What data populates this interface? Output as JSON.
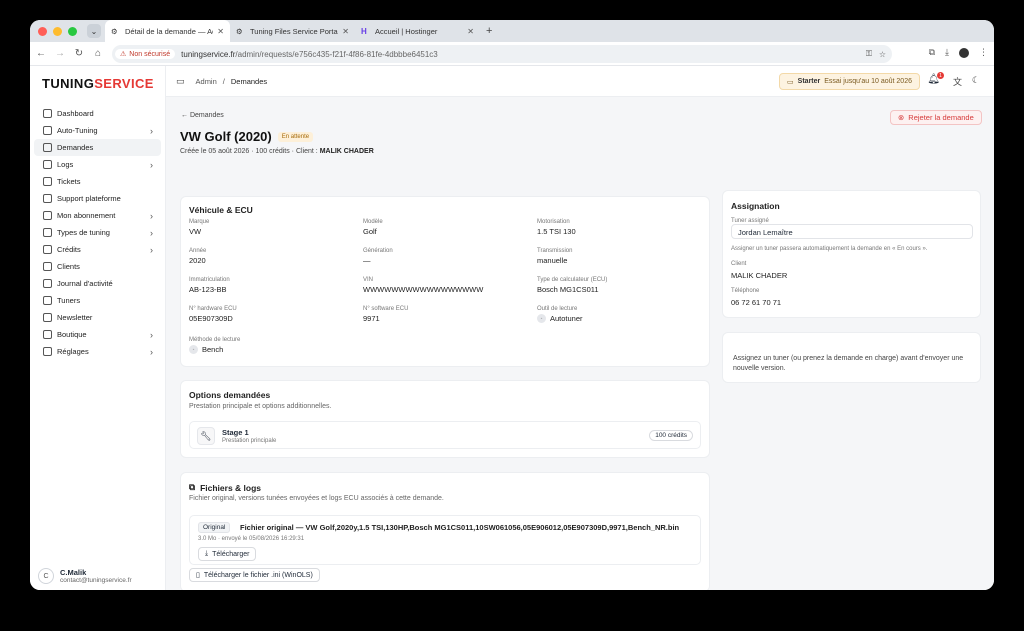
{
  "browser": {
    "tabs": [
      {
        "label": "Détail de la demande — Admi",
        "active": true
      },
      {
        "label": "Tuning Files Service Portal –",
        "active": false
      },
      {
        "label": "Accueil | Hostinger",
        "active": false
      }
    ],
    "insecure_label": "Non sécurisé",
    "url_host": "tuningservice.fr",
    "url_path": "/admin/requests/e756c435-f21f-4f86-81fe-4dbbbe6451c3"
  },
  "sidebar": {
    "brand_a": "TUNING",
    "brand_b": "SERVICE",
    "items": [
      {
        "label": "Dashboard",
        "icon": "grid-icon",
        "arrow": false
      },
      {
        "label": "Auto-Tuning",
        "icon": "cpu-icon",
        "arrow": true
      },
      {
        "label": "Demandes",
        "icon": "file-icon",
        "arrow": false,
        "active": true
      },
      {
        "label": "Logs",
        "icon": "doc-icon",
        "arrow": true
      },
      {
        "label": "Tickets",
        "icon": "ticket-icon",
        "arrow": false
      },
      {
        "label": "Support plateforme",
        "icon": "help-icon",
        "arrow": false
      },
      {
        "label": "Mon abonnement",
        "icon": "card-icon",
        "arrow": true
      },
      {
        "label": "Types de tuning",
        "icon": "car-icon",
        "arrow": true
      },
      {
        "label": "Crédits",
        "icon": "coins-icon",
        "arrow": true
      },
      {
        "label": "Clients",
        "icon": "users-icon",
        "arrow": false
      },
      {
        "label": "Journal d'activité",
        "icon": "history-icon",
        "arrow": false
      },
      {
        "label": "Tuners",
        "icon": "wrench-icon",
        "arrow": false
      },
      {
        "label": "Newsletter",
        "icon": "mail-icon",
        "arrow": false
      },
      {
        "label": "Boutique",
        "icon": "shop-icon",
        "arrow": true
      },
      {
        "label": "Réglages",
        "icon": "gear-icon",
        "arrow": true
      }
    ],
    "user": {
      "initial": "C",
      "name": "C.Malik",
      "email": "contact@tuningservice.fr"
    }
  },
  "topbar": {
    "crumb_root": "Admin",
    "crumb_current": "Demandes",
    "plan_name": "Starter",
    "plan_note": "Essai jusqu'au 10 août 2026",
    "notif_count": "1"
  },
  "page": {
    "back_label": "Demandes",
    "reject_label": "Rejeter la demande",
    "title": "VW Golf (2020)",
    "status": "En attente",
    "meta_prefix": "Créée le 05 août 2026 · 100 crédits · Client : ",
    "meta_client": "MALIK CHADER"
  },
  "vehicle": {
    "title": "Véhicule & ECU",
    "fields": [
      {
        "label": "Marque",
        "value": "VW"
      },
      {
        "label": "Modèle",
        "value": "Golf"
      },
      {
        "label": "Motorisation",
        "value": "1.5 TSI 130"
      },
      {
        "label": "Année",
        "value": "2020"
      },
      {
        "label": "Génération",
        "value": "—"
      },
      {
        "label": "Transmission",
        "value": "manuelle"
      },
      {
        "label": "Immatriculation",
        "value": "AB-123-BB"
      },
      {
        "label": "VIN",
        "value": "WWWWWWWWWWWWWWWWW"
      },
      {
        "label": "Type de calculateur (ECU)",
        "value": "Bosch MG1CS011"
      },
      {
        "label": "N° hardware ECU",
        "value": "05E907309D"
      },
      {
        "label": "N° software ECU",
        "value": "9971"
      },
      {
        "label": "Outil de lecture",
        "value": "Autotuner"
      },
      {
        "label": "Méthode de lecture",
        "value": "Bench"
      }
    ]
  },
  "options": {
    "title": "Options demandées",
    "subtitle": "Prestation principale et options additionnelles.",
    "item_title": "Stage 1",
    "item_sub": "Prestation principale",
    "item_credits": "100 crédits"
  },
  "files": {
    "title": "Fichiers & logs",
    "subtitle": "Fichier original, versions tunées envoyées et logs ECU associés à cette demande.",
    "tag": "Original",
    "name": "Fichier original — VW Golf,2020y,1.5 TSI,130HP,Bosch MG1CS011,10SW061056,05E906012,05E907309D,9971,Bench_NR.bin",
    "meta": "3.0 Mo · envoyé le 05/08/2026 16:29:31",
    "download_label": "Télécharger",
    "ini_label": "Télécharger le fichier .ini (WinOLS)"
  },
  "assign": {
    "title": "Assignation",
    "tuner_label": "Tuner assigné",
    "tuner_value": "Jordan Lemaître",
    "hint": "Assigner un tuner passera automatiquement la demande en « En cours ».",
    "client_label": "Client",
    "client_value": "MALIK CHADER",
    "phone_label": "Téléphone",
    "phone_value": "06 72 61 70 71"
  },
  "notice": {
    "text": "Assignez un tuner (ou prenez la demande en charge) avant d'envoyer une nouvelle version."
  }
}
